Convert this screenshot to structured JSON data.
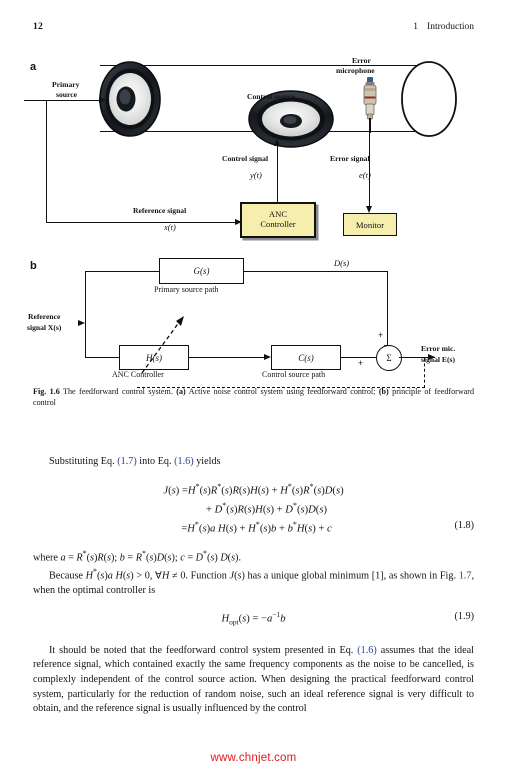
{
  "running_head": {
    "page_number": "12",
    "chapter_number": "1",
    "chapter_title": "Introduction"
  },
  "figure": {
    "panel_a": {
      "letter": "a",
      "labels": {
        "primary_source_line1": "Primary",
        "primary_source_line2": "source",
        "control_source": "Control source",
        "error_microphone_line1": "Error",
        "error_microphone_line2": "microphone",
        "control_signal": "Control signal",
        "control_signal_var": "y(t)",
        "error_signal": "Error signal",
        "error_signal_var": "e(t)",
        "reference_signal": "Reference signal",
        "reference_signal_var": "x(t)",
        "anc_controller_line1": "ANC",
        "anc_controller_line2": "Controller",
        "monitor": "Monitor"
      }
    },
    "panel_b": {
      "letter": "b",
      "labels": {
        "reference_signal_line1": "Reference",
        "reference_signal_line2": "signal X(s)",
        "primary_path_tf": "G(s)",
        "primary_path_name": "Primary source path",
        "anc_tf": "H(s)",
        "anc_name": "ANC Controller",
        "control_path_tf": "C(s)",
        "control_path_name": "Control source path",
        "disturbance": "D(s)",
        "sum_symbol": "Σ",
        "plus_top": "+",
        "plus_left": "+",
        "error_mic_line1": "Error mic.",
        "error_mic_line2": "signal E(s)"
      }
    },
    "caption": {
      "number": "Fig. 1.6",
      "text_1": " The feedforward control system. ",
      "bold_a": "(a)",
      "text_2": " Active noise control system using feedforward control; ",
      "bold_b": "(b)",
      "text_3": " principle of feedforward control"
    }
  },
  "body": {
    "intro_pre": "Substituting Eq. ",
    "intro_ref1": "(1.7)",
    "intro_mid": " into Eq. ",
    "intro_ref2": "(1.6)",
    "intro_post": " yields",
    "eq18": {
      "line1": "J(s) =H*(s)R*(s)R(s)H(s) + H*(s)R*(s)D(s)",
      "line2": "+ D*(s)R(s)H(s) + D*(s)D(s)",
      "line3": "=H*(s)a H(s) + H*(s) b + b*H(s) + c",
      "number": "(1.8)"
    },
    "where_line": "where a = R*(s)R(s); b = R*(s)D(s); c = D*(s) D(s).",
    "because_pre": "Because H*(s)a H(s) > 0, ∀H ≠ 0. Function J(s) has a unique global minimum [1], as shown in Fig. ",
    "because_ref": "1.7",
    "because_post": ", when the optimal controller is",
    "eq19": {
      "body": "H",
      "sub": "opt",
      "rest": "(s) = −a−1b",
      "number": "(1.9)"
    },
    "final_pre": "It should be noted that the feedforward control system presented in Eq. ",
    "final_ref": "(1.6)",
    "final_post": " assumes that the ideal reference signal, which contained exactly the same frequency components as the noise to be cancelled, is complexly independent of the control source action. When designing the practical feedforward control system, particularly for the reduction of random noise, such an ideal reference signal is very difficult to obtain, and the reference signal is usually influenced by the control"
  },
  "watermark": {
    "text": "www.chnjet.com",
    "color": "#e01b1b"
  }
}
